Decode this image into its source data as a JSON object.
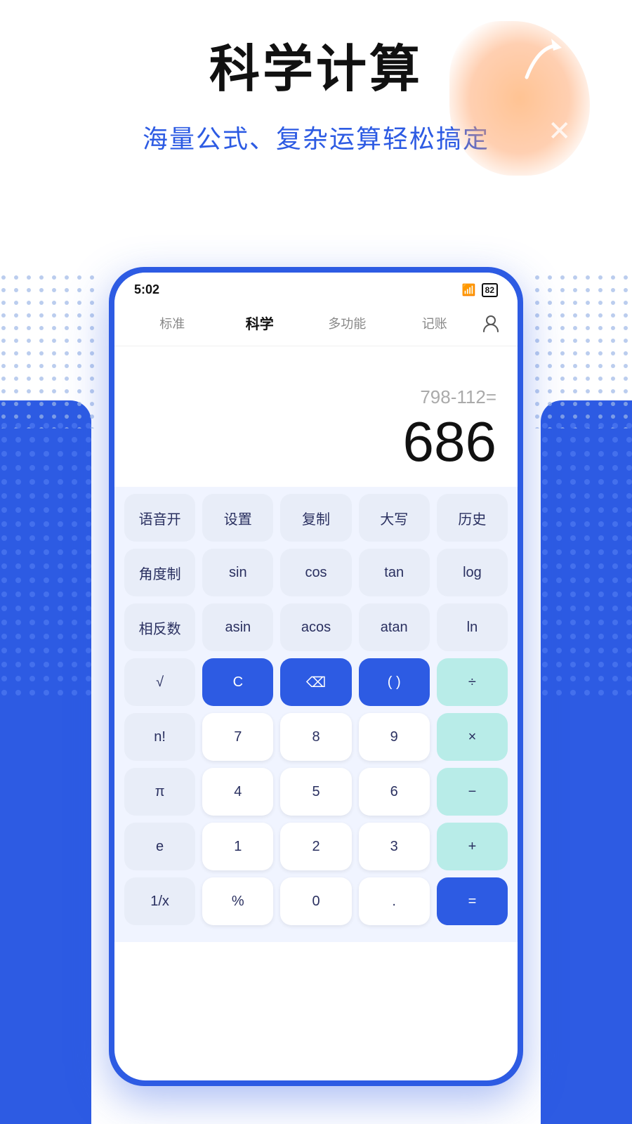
{
  "header": {
    "main_title": "科学计算",
    "sub_title": "海量公式、复杂运算轻松搞定"
  },
  "status_bar": {
    "time": "5:02",
    "battery": "82"
  },
  "nav": {
    "tabs": [
      {
        "label": "标准",
        "active": false
      },
      {
        "label": "科学",
        "active": true
      },
      {
        "label": "多功能",
        "active": false
      },
      {
        "label": "记账",
        "active": false
      }
    ]
  },
  "display": {
    "expression": "798-112=",
    "result": "686"
  },
  "keyboard": {
    "rows": [
      [
        {
          "label": "语音开",
          "type": "light"
        },
        {
          "label": "设置",
          "type": "light"
        },
        {
          "label": "复制",
          "type": "light"
        },
        {
          "label": "大写",
          "type": "light"
        },
        {
          "label": "历史",
          "type": "light"
        }
      ],
      [
        {
          "label": "角度制",
          "type": "light"
        },
        {
          "label": "sin",
          "type": "light"
        },
        {
          "label": "cos",
          "type": "light"
        },
        {
          "label": "tan",
          "type": "light"
        },
        {
          "label": "log",
          "type": "light"
        }
      ],
      [
        {
          "label": "相反数",
          "type": "light"
        },
        {
          "label": "asin",
          "type": "light"
        },
        {
          "label": "acos",
          "type": "light"
        },
        {
          "label": "atan",
          "type": "light"
        },
        {
          "label": "ln",
          "type": "light"
        }
      ],
      [
        {
          "label": "√",
          "type": "light"
        },
        {
          "label": "C",
          "type": "blue-dark"
        },
        {
          "label": "⌫",
          "type": "blue-dark"
        },
        {
          "label": "( )",
          "type": "blue-dark"
        },
        {
          "label": "÷",
          "type": "teal"
        }
      ],
      [
        {
          "label": "n!",
          "type": "light"
        },
        {
          "label": "7",
          "type": "white"
        },
        {
          "label": "8",
          "type": "white"
        },
        {
          "label": "9",
          "type": "white"
        },
        {
          "label": "×",
          "type": "teal"
        }
      ],
      [
        {
          "label": "π",
          "type": "light"
        },
        {
          "label": "4",
          "type": "white"
        },
        {
          "label": "5",
          "type": "white"
        },
        {
          "label": "6",
          "type": "white"
        },
        {
          "label": "−",
          "type": "teal"
        }
      ],
      [
        {
          "label": "e",
          "type": "light"
        },
        {
          "label": "1",
          "type": "white"
        },
        {
          "label": "2",
          "type": "white"
        },
        {
          "label": "3",
          "type": "white"
        },
        {
          "label": "+",
          "type": "teal"
        }
      ],
      [
        {
          "label": "1/x",
          "type": "light"
        },
        {
          "label": "%",
          "type": "white"
        },
        {
          "label": "0",
          "type": "white"
        },
        {
          "label": ".",
          "type": "white"
        },
        {
          "label": "=",
          "type": "equals"
        }
      ]
    ]
  }
}
